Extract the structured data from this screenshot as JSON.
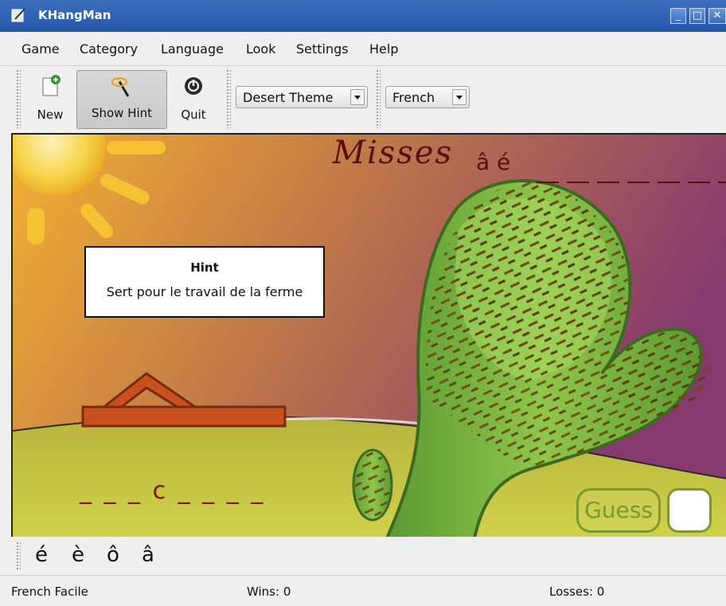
{
  "window": {
    "title": "KHangMan"
  },
  "menu": [
    "Game",
    "Category",
    "Language",
    "Look",
    "Settings",
    "Help"
  ],
  "toolbar": {
    "new_label": "New",
    "hint_label": "Show Hint",
    "quit_label": "Quit",
    "theme_value": "Desert Theme",
    "language_value": "French"
  },
  "game": {
    "misses_label": "Misses",
    "missed_letters": "â é",
    "hint_title": "Hint",
    "hint_text": "Sert pour le travail de la ferme",
    "word_pattern": "_ _ _ c _ _ _ _",
    "guess_label": "Guess",
    "guess_value": ""
  },
  "special_chars": [
    "é",
    "è",
    "ô",
    "â"
  ],
  "status": {
    "language_level": "French  Facile",
    "wins": "Wins: 0",
    "losses": "Losses: 0"
  },
  "colors": {
    "titlebar": "#2d5fb3",
    "scene_sky_left": "#f2b132",
    "scene_sky_right": "#8a3b72",
    "ground": "#c8c84a",
    "cactus": "#6aa83a",
    "text_red": "#5a1010"
  }
}
